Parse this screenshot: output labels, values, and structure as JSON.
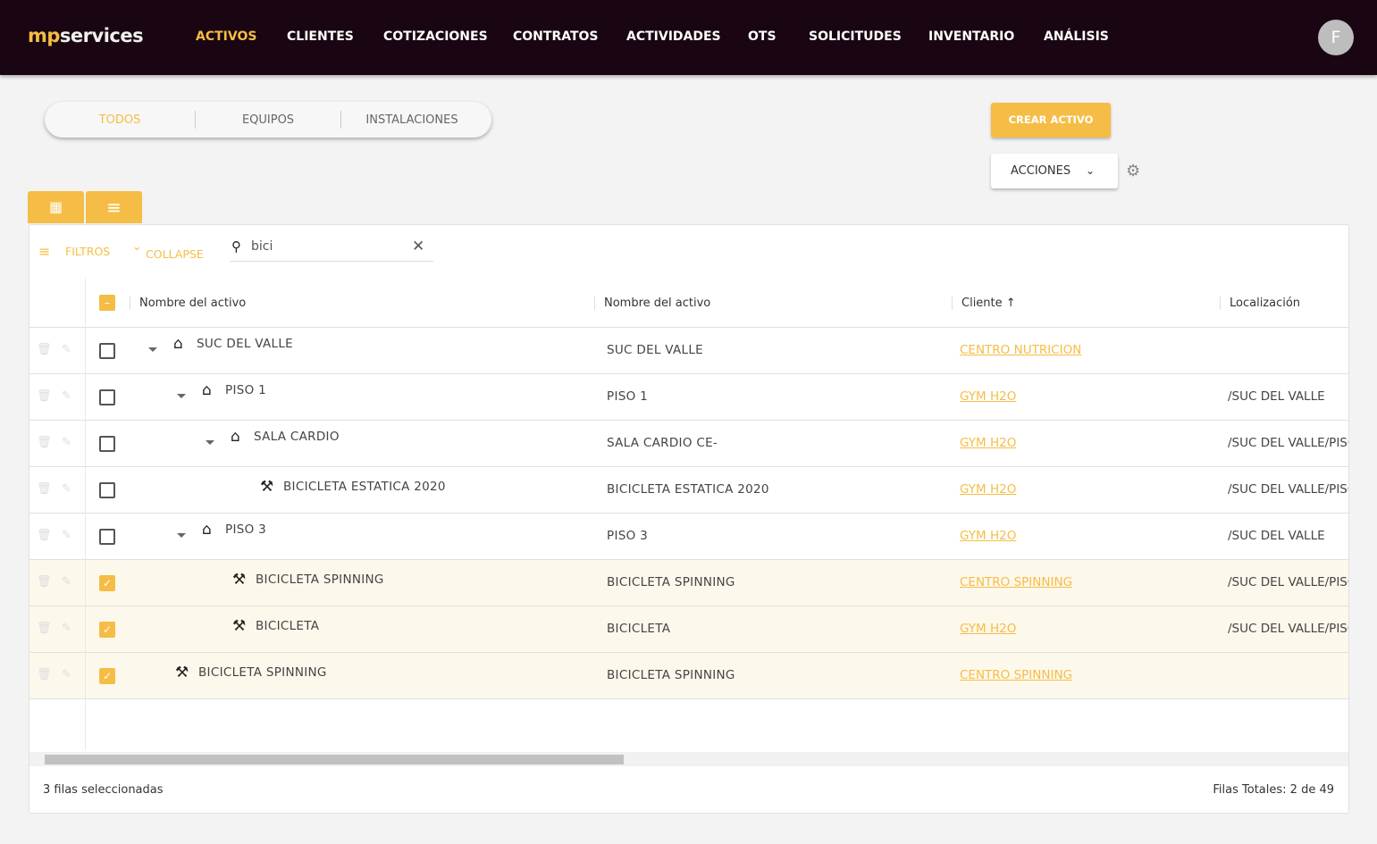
{
  "nav": {
    "logo_a": "mp",
    "logo_b": "services",
    "items": [
      "ACTIVOS",
      "CLIENTES",
      "COTIZACIONES",
      "CONTRATOS",
      "ACTIVIDADES",
      "OTS",
      "SOLICITUDES",
      "INVENTARIO",
      "ANÁLISIS"
    ],
    "active": "ACTIVOS",
    "avatar": "F"
  },
  "tabs": [
    "TODOS",
    "EQUIPOS",
    "INSTALACIONES"
  ],
  "buttons": {
    "create": "CREAR ACTIVO",
    "actions": "ACCIONES"
  },
  "toolbar": {
    "filters": "FILTROS",
    "collapse": "COLLAPSE",
    "search_value": "bici"
  },
  "columns": [
    "Nombre del activo",
    "Nombre del activo",
    "Cliente",
    "Localización"
  ],
  "rows": [
    {
      "name": "SUC DEL VALLE",
      "type": "installation",
      "level": 0,
      "expand": true,
      "name2": "SUC DEL VALLE",
      "client": "CENTRO NUTRICION",
      "loc": "",
      "checked": false
    },
    {
      "name": "PISO 1",
      "type": "installation",
      "level": 1,
      "expand": true,
      "name2": "PISO 1",
      "client": "GYM H2O",
      "loc": "/SUC DEL VALLE",
      "checked": false
    },
    {
      "name": "SALA CARDIO",
      "type": "installation",
      "level": 2,
      "expand": true,
      "name2": "SALA CARDIO CE-",
      "client": "GYM H2O",
      "loc": "/SUC DEL VALLE/PISO",
      "checked": false
    },
    {
      "name": "BICICLETA ESTATICA 2020",
      "type": "equipment",
      "level": 3,
      "expand": false,
      "name2": "BICICLETA ESTATICA 2020",
      "client": "GYM H2O",
      "loc": "/SUC DEL VALLE/PISO",
      "checked": false
    },
    {
      "name": "PISO 3",
      "type": "installation",
      "level": 1,
      "expand": true,
      "name2": "PISO 3",
      "client": "GYM H2O",
      "loc": "/SUC DEL VALLE",
      "checked": false
    },
    {
      "name": "BICICLETA SPINNING",
      "type": "equipment",
      "level": 2,
      "expand": false,
      "name2": "BICICLETA SPINNING",
      "client": "CENTRO SPINNING",
      "loc": "/SUC DEL VALLE/PISO",
      "checked": true
    },
    {
      "name": "BICICLETA",
      "type": "equipment",
      "level": 2,
      "expand": false,
      "name2": "BICICLETA",
      "client": "GYM H2O",
      "loc": "/SUC DEL VALLE/PISO",
      "checked": true
    },
    {
      "name": "BICICLETA SPINNING",
      "type": "equipment",
      "level": 0,
      "expand": false,
      "name2": "BICICLETA SPINNING",
      "client": "CENTRO SPINNING",
      "loc": "",
      "checked": true
    }
  ],
  "footer": {
    "selected": "3 filas seleccionadas",
    "total": "Filas Totales: 2 de 49"
  },
  "colors": {
    "accent": "#f5bd45",
    "nav_bg": "#1a0612"
  }
}
